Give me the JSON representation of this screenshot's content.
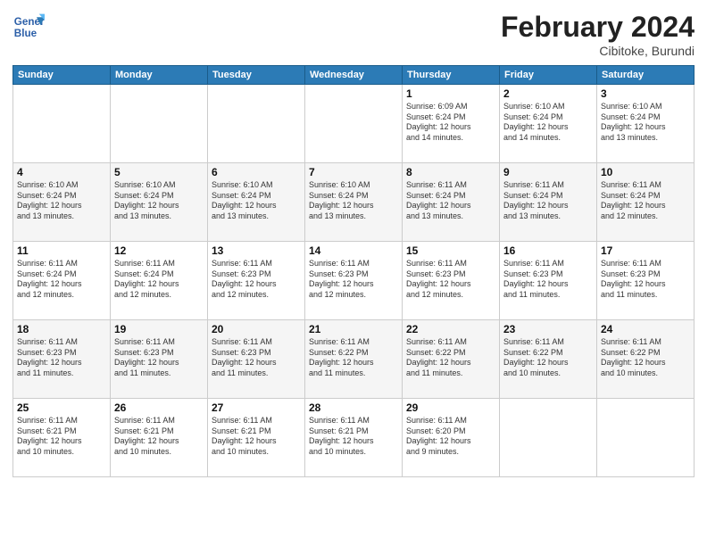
{
  "header": {
    "logo_line1": "General",
    "logo_line2": "Blue",
    "month": "February 2024",
    "location": "Cibitoke, Burundi"
  },
  "days_of_week": [
    "Sunday",
    "Monday",
    "Tuesday",
    "Wednesday",
    "Thursday",
    "Friday",
    "Saturday"
  ],
  "weeks": [
    [
      {
        "day": "",
        "info": ""
      },
      {
        "day": "",
        "info": ""
      },
      {
        "day": "",
        "info": ""
      },
      {
        "day": "",
        "info": ""
      },
      {
        "day": "1",
        "info": "Sunrise: 6:09 AM\nSunset: 6:24 PM\nDaylight: 12 hours\nand 14 minutes."
      },
      {
        "day": "2",
        "info": "Sunrise: 6:10 AM\nSunset: 6:24 PM\nDaylight: 12 hours\nand 14 minutes."
      },
      {
        "day": "3",
        "info": "Sunrise: 6:10 AM\nSunset: 6:24 PM\nDaylight: 12 hours\nand 13 minutes."
      }
    ],
    [
      {
        "day": "4",
        "info": "Sunrise: 6:10 AM\nSunset: 6:24 PM\nDaylight: 12 hours\nand 13 minutes."
      },
      {
        "day": "5",
        "info": "Sunrise: 6:10 AM\nSunset: 6:24 PM\nDaylight: 12 hours\nand 13 minutes."
      },
      {
        "day": "6",
        "info": "Sunrise: 6:10 AM\nSunset: 6:24 PM\nDaylight: 12 hours\nand 13 minutes."
      },
      {
        "day": "7",
        "info": "Sunrise: 6:10 AM\nSunset: 6:24 PM\nDaylight: 12 hours\nand 13 minutes."
      },
      {
        "day": "8",
        "info": "Sunrise: 6:11 AM\nSunset: 6:24 PM\nDaylight: 12 hours\nand 13 minutes."
      },
      {
        "day": "9",
        "info": "Sunrise: 6:11 AM\nSunset: 6:24 PM\nDaylight: 12 hours\nand 13 minutes."
      },
      {
        "day": "10",
        "info": "Sunrise: 6:11 AM\nSunset: 6:24 PM\nDaylight: 12 hours\nand 12 minutes."
      }
    ],
    [
      {
        "day": "11",
        "info": "Sunrise: 6:11 AM\nSunset: 6:24 PM\nDaylight: 12 hours\nand 12 minutes."
      },
      {
        "day": "12",
        "info": "Sunrise: 6:11 AM\nSunset: 6:24 PM\nDaylight: 12 hours\nand 12 minutes."
      },
      {
        "day": "13",
        "info": "Sunrise: 6:11 AM\nSunset: 6:23 PM\nDaylight: 12 hours\nand 12 minutes."
      },
      {
        "day": "14",
        "info": "Sunrise: 6:11 AM\nSunset: 6:23 PM\nDaylight: 12 hours\nand 12 minutes."
      },
      {
        "day": "15",
        "info": "Sunrise: 6:11 AM\nSunset: 6:23 PM\nDaylight: 12 hours\nand 12 minutes."
      },
      {
        "day": "16",
        "info": "Sunrise: 6:11 AM\nSunset: 6:23 PM\nDaylight: 12 hours\nand 11 minutes."
      },
      {
        "day": "17",
        "info": "Sunrise: 6:11 AM\nSunset: 6:23 PM\nDaylight: 12 hours\nand 11 minutes."
      }
    ],
    [
      {
        "day": "18",
        "info": "Sunrise: 6:11 AM\nSunset: 6:23 PM\nDaylight: 12 hours\nand 11 minutes."
      },
      {
        "day": "19",
        "info": "Sunrise: 6:11 AM\nSunset: 6:23 PM\nDaylight: 12 hours\nand 11 minutes."
      },
      {
        "day": "20",
        "info": "Sunrise: 6:11 AM\nSunset: 6:23 PM\nDaylight: 12 hours\nand 11 minutes."
      },
      {
        "day": "21",
        "info": "Sunrise: 6:11 AM\nSunset: 6:22 PM\nDaylight: 12 hours\nand 11 minutes."
      },
      {
        "day": "22",
        "info": "Sunrise: 6:11 AM\nSunset: 6:22 PM\nDaylight: 12 hours\nand 11 minutes."
      },
      {
        "day": "23",
        "info": "Sunrise: 6:11 AM\nSunset: 6:22 PM\nDaylight: 12 hours\nand 10 minutes."
      },
      {
        "day": "24",
        "info": "Sunrise: 6:11 AM\nSunset: 6:22 PM\nDaylight: 12 hours\nand 10 minutes."
      }
    ],
    [
      {
        "day": "25",
        "info": "Sunrise: 6:11 AM\nSunset: 6:21 PM\nDaylight: 12 hours\nand 10 minutes."
      },
      {
        "day": "26",
        "info": "Sunrise: 6:11 AM\nSunset: 6:21 PM\nDaylight: 12 hours\nand 10 minutes."
      },
      {
        "day": "27",
        "info": "Sunrise: 6:11 AM\nSunset: 6:21 PM\nDaylight: 12 hours\nand 10 minutes."
      },
      {
        "day": "28",
        "info": "Sunrise: 6:11 AM\nSunset: 6:21 PM\nDaylight: 12 hours\nand 10 minutes."
      },
      {
        "day": "29",
        "info": "Sunrise: 6:11 AM\nSunset: 6:20 PM\nDaylight: 12 hours\nand 9 minutes."
      },
      {
        "day": "",
        "info": ""
      },
      {
        "day": "",
        "info": ""
      }
    ]
  ]
}
